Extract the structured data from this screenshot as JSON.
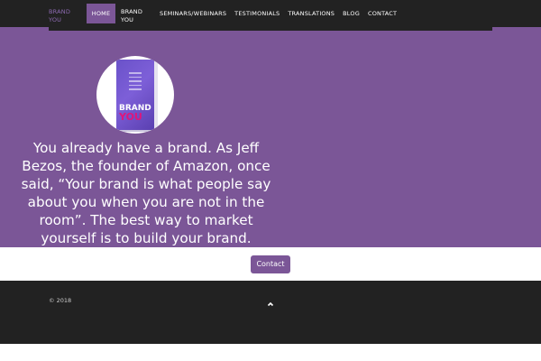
{
  "nav": {
    "brand_line1": "BRAND",
    "brand_line2": "YOU",
    "home": "HOME",
    "brandyou_line1": "BRAND",
    "brandyou_line2": "YOU",
    "seminars": "SEMINARS/WEBINARS",
    "testimonials": "TESTIMONIALS",
    "translations": "TRANSLATIONS",
    "blog": "BLOG",
    "contact": "CONTACT"
  },
  "hero": {
    "book_title_line1": "BRAND",
    "book_title_line2": "YOU",
    "quote": "You already have a brand. As Jeff Bezos, the founder of Amazon, once said, “Your brand is what people say about you when you are not in the room”. The best way to market yourself is to build your brand."
  },
  "contact_button": "Contact",
  "footer": {
    "copyright": "©  2018"
  },
  "colors": {
    "accent": "#7b5697",
    "dark": "#222222",
    "brand_text": "#8e6bb3"
  },
  "icons": {
    "back_to_top": "chevron-up-icon"
  }
}
